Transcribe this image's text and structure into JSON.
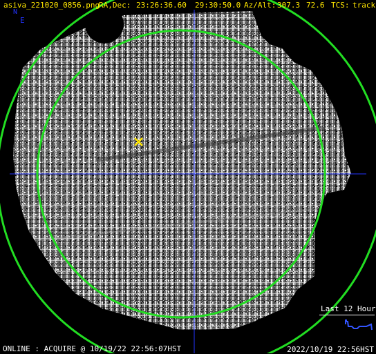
{
  "header": {
    "filename": "asiva_221020_0856.png",
    "radec_label": "RA,Dec:",
    "ra": "23:26:36.60",
    "dec": "29:30:50.0",
    "azalt_label": "Az/Alt:",
    "az": "307.3",
    "alt": "72.6",
    "tcs_label": "TCS:",
    "tcs_value": "track"
  },
  "compass": {
    "north": "N",
    "east": "E"
  },
  "status": {
    "line": "ONLINE : ACQUIRE @ 10/19/22 22:56:07HST"
  },
  "footer": {
    "timestamp": "2022/10/19 22:56HST"
  },
  "history": {
    "label": "Last 12 Hours"
  },
  "colors": {
    "header_text": "#ffe600",
    "crosshair": "#2233ff",
    "circle": "#22dd22",
    "target_marker": "#ffe600",
    "background": "#000000"
  },
  "icons": {
    "target_marker": "x-mark-icon",
    "sparkline": "sparkline-icon"
  }
}
